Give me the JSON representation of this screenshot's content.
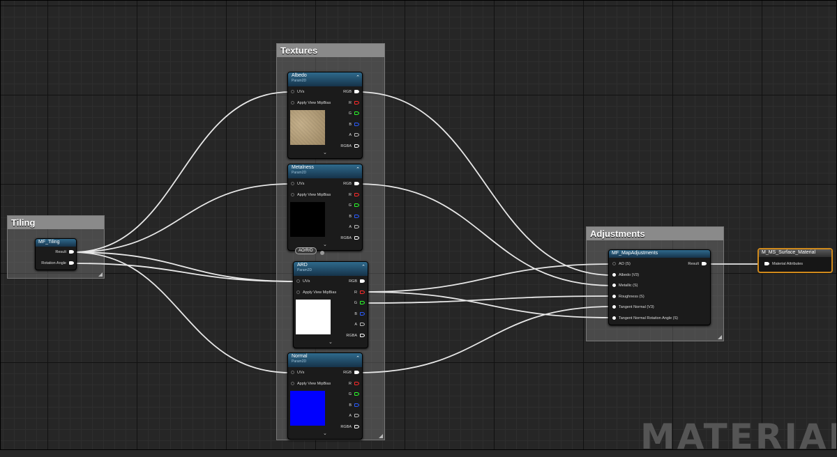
{
  "watermark": "MATERIAL",
  "comments": {
    "textures": "Textures",
    "tiling": "Tiling",
    "adjustments": "Adjustments"
  },
  "tiling_node": {
    "title": "MF_Tiling",
    "outputs": [
      "Result",
      "Rotation Angle"
    ]
  },
  "texture_nodes": [
    {
      "title": "Albedo",
      "subtitle": "Param2D",
      "preview_color": "#b5a07c"
    },
    {
      "title": "Metalness",
      "subtitle": "Param2D",
      "preview_color": "#000000"
    },
    {
      "title": "ARD",
      "subtitle": "Param2D",
      "preview_color": "#ffffff"
    },
    {
      "title": "Normal",
      "subtitle": "Param2D",
      "preview_color": "#0000ff"
    }
  ],
  "texture_pins": {
    "inputs": [
      "UVs",
      "Apply View MipBias"
    ],
    "outputs": [
      "RGB",
      "R",
      "G",
      "B",
      "A",
      "RGBA"
    ],
    "output_colors": [
      "#ffffff",
      "#ff2a2a",
      "#2aff2a",
      "#2a5cff",
      "#bbbbbb",
      "#ffffff"
    ]
  },
  "reroute_badge": "AO/R/D",
  "adjust_node": {
    "title": "MF_MapAdjustments",
    "inputs": [
      "AO (S)",
      "Albedo (V3)",
      "Metallic (S)",
      "Roughness (S)",
      "Tangent Normal (V3)",
      "Tangent Normal Rotation Angle (S)"
    ],
    "output": "Result"
  },
  "output_node": {
    "title": "M_MS_Surface_Material",
    "input": "Material Attributes"
  },
  "colors": {
    "accent_output_border": "#d08a1c",
    "node_header": "#2f6a8c",
    "wire": "#e8e8e8"
  }
}
